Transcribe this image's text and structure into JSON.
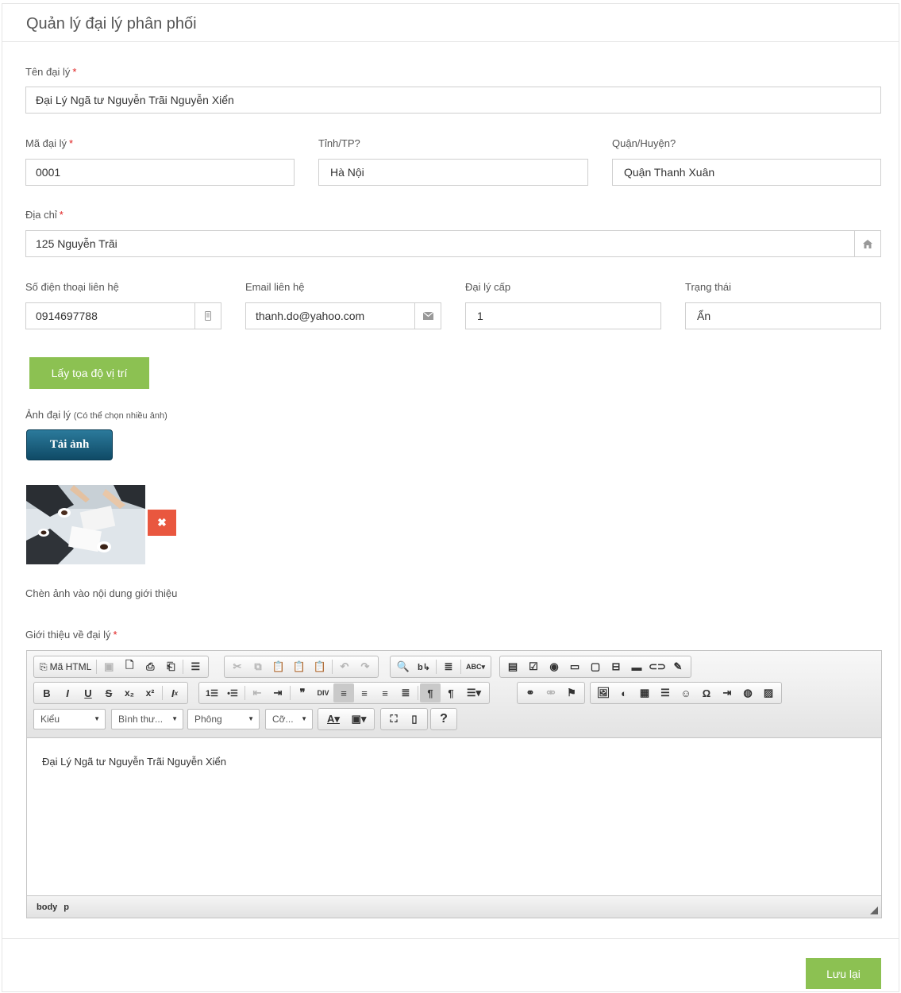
{
  "page": {
    "title": "Quản lý đại lý phân phối"
  },
  "form": {
    "name": {
      "label": "Tên đại lý",
      "value": "Đại Lý Ngã tư Nguyễn Trãi Nguyễn Xiển"
    },
    "code": {
      "label": "Mã đại lý",
      "value": "0001"
    },
    "province": {
      "label": "Tỉnh/TP?",
      "value": "Hà Nội"
    },
    "district": {
      "label": "Quận/Huyện?",
      "value": "Quận Thanh Xuân"
    },
    "address": {
      "label": "Địa chỉ",
      "value": "125 Nguyễn Trãi"
    },
    "phone": {
      "label": "Số điện thoại liên hệ",
      "value": "0914697788"
    },
    "email": {
      "label": "Email liên hệ",
      "value": "thanh.do@yahoo.com"
    },
    "level": {
      "label": "Đại lý cấp",
      "value": "1"
    },
    "status": {
      "label": "Trạng thái",
      "value": "Ẩn"
    },
    "required_mark": "*",
    "locate_button": "Lấy tọa độ vị trí",
    "images": {
      "label": "Ảnh đại lý",
      "hint": "(Có thể chọn nhiều ảnh)",
      "upload_button": "Tải ảnh",
      "delete_icon": "✖"
    },
    "insert_image_label": "Chèn ảnh vào nội dung giới thiệu",
    "intro": {
      "label": "Giới thiệu về đại lý",
      "content": "Đại Lý Ngã tư Nguyễn Trãi Nguyễn Xiển"
    }
  },
  "editor": {
    "source_label": "Mã HTML",
    "combos": {
      "style": "Kiểu",
      "format": "Bình thư...",
      "font": "Phông",
      "size": "Cỡ..."
    },
    "path": [
      "body",
      "p"
    ]
  },
  "footer": {
    "save_button": "Lưu lại"
  },
  "colors": {
    "accent_green": "#8cc152",
    "upload_blue": "#1b5f80",
    "delete_red": "#e9573f"
  }
}
